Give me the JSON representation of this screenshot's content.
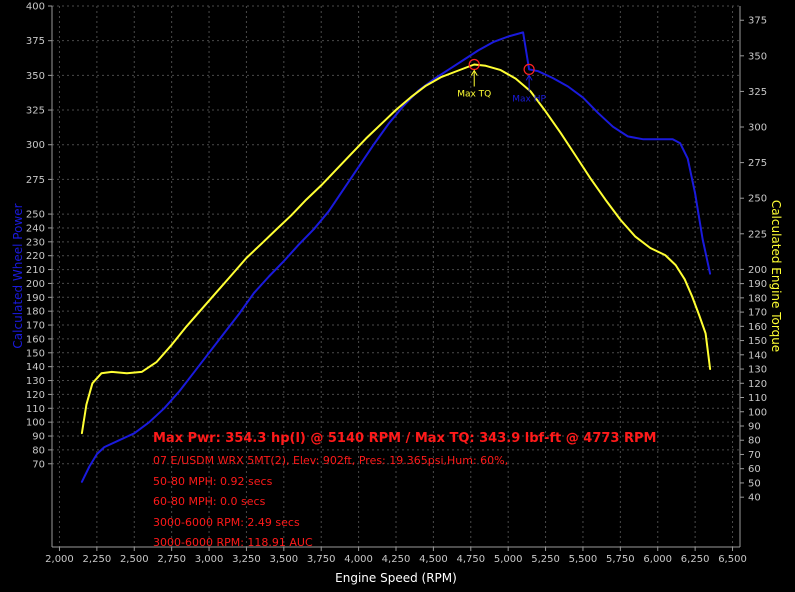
{
  "chart_data": {
    "type": "line",
    "xlabel": "Engine Speed (RPM)",
    "ylabel_left": "Calculated Wheel Power",
    "ylabel_right": "Calculated Engine Torque",
    "xlim": [
      1950,
      6550
    ],
    "ylim_left": [
      10,
      400
    ],
    "ylim_right": [
      5,
      385
    ],
    "x_ticks": [
      {
        "v": 2000,
        "label": "2,000"
      },
      {
        "v": 2250,
        "label": "2,250"
      },
      {
        "v": 2500,
        "label": "2,500"
      },
      {
        "v": 2750,
        "label": "2,750"
      },
      {
        "v": 3000,
        "label": "3,000"
      },
      {
        "v": 3250,
        "label": "3,250"
      },
      {
        "v": 3500,
        "label": "3,500"
      },
      {
        "v": 3750,
        "label": "3,750"
      },
      {
        "v": 4000,
        "label": "4,000"
      },
      {
        "v": 4250,
        "label": "4,250"
      },
      {
        "v": 4500,
        "label": "4,500"
      },
      {
        "v": 4750,
        "label": "4,750"
      },
      {
        "v": 5000,
        "label": "5,000"
      },
      {
        "v": 5250,
        "label": "5,250"
      },
      {
        "v": 5500,
        "label": "5,500"
      },
      {
        "v": 5750,
        "label": "5,750"
      },
      {
        "v": 6000,
        "label": "6,000"
      },
      {
        "v": 6250,
        "label": "6,250"
      },
      {
        "v": 6500,
        "label": "6,500"
      }
    ],
    "y_left_ticks": [
      70,
      80,
      90,
      100,
      110,
      120,
      130,
      140,
      150,
      160,
      170,
      180,
      190,
      200,
      210,
      220,
      230,
      240,
      250,
      275,
      300,
      325,
      350,
      375,
      400
    ],
    "y_right_ticks": [
      40,
      50,
      60,
      70,
      80,
      90,
      100,
      110,
      120,
      130,
      140,
      150,
      160,
      170,
      180,
      190,
      200,
      225,
      250,
      275,
      300,
      325,
      350,
      375
    ],
    "grid": true,
    "series": [
      {
        "name": "",
        "axis": "left",
        "color": "#1a1adc",
        "points": [
          [
            2150,
            57
          ],
          [
            2200,
            68
          ],
          [
            2250,
            77
          ],
          [
            2300,
            82
          ],
          [
            2400,
            87
          ],
          [
            2500,
            92
          ],
          [
            2600,
            100
          ],
          [
            2700,
            110
          ],
          [
            2800,
            122
          ],
          [
            2900,
            136
          ],
          [
            3000,
            150
          ],
          [
            3100,
            164
          ],
          [
            3200,
            178
          ],
          [
            3300,
            193
          ],
          [
            3400,
            205
          ],
          [
            3500,
            216
          ],
          [
            3600,
            228
          ],
          [
            3700,
            239
          ],
          [
            3800,
            252
          ],
          [
            3900,
            268
          ],
          [
            4000,
            284
          ],
          [
            4100,
            300
          ],
          [
            4200,
            315
          ],
          [
            4300,
            328
          ],
          [
            4400,
            339
          ],
          [
            4500,
            347
          ],
          [
            4600,
            354
          ],
          [
            4700,
            361
          ],
          [
            4800,
            368
          ],
          [
            4900,
            374
          ],
          [
            5000,
            378
          ],
          [
            5100,
            381
          ],
          [
            5140,
            354.3
          ],
          [
            5200,
            353
          ],
          [
            5300,
            348
          ],
          [
            5400,
            342
          ],
          [
            5500,
            334
          ],
          [
            5600,
            323
          ],
          [
            5700,
            313
          ],
          [
            5800,
            306
          ],
          [
            5900,
            304
          ],
          [
            6000,
            304
          ],
          [
            6100,
            304
          ],
          [
            6150,
            301
          ],
          [
            6200,
            290
          ],
          [
            6250,
            265
          ],
          [
            6300,
            232
          ],
          [
            6350,
            207
          ]
        ]
      },
      {
        "name": "",
        "axis": "right",
        "color": "#ffff33",
        "points": [
          [
            2150,
            85
          ],
          [
            2180,
            105
          ],
          [
            2220,
            120
          ],
          [
            2280,
            127
          ],
          [
            2350,
            128
          ],
          [
            2450,
            127
          ],
          [
            2550,
            128
          ],
          [
            2650,
            135
          ],
          [
            2750,
            147
          ],
          [
            2850,
            160
          ],
          [
            2950,
            172
          ],
          [
            3050,
            184
          ],
          [
            3150,
            196
          ],
          [
            3250,
            208
          ],
          [
            3350,
            218
          ],
          [
            3450,
            228
          ],
          [
            3550,
            238
          ],
          [
            3650,
            249
          ],
          [
            3750,
            259
          ],
          [
            3850,
            270
          ],
          [
            3950,
            281
          ],
          [
            4050,
            292
          ],
          [
            4150,
            302
          ],
          [
            4250,
            312
          ],
          [
            4350,
            321
          ],
          [
            4450,
            329
          ],
          [
            4550,
            335
          ],
          [
            4650,
            339
          ],
          [
            4773,
            343.9
          ],
          [
            4850,
            343
          ],
          [
            4950,
            340
          ],
          [
            5050,
            334
          ],
          [
            5150,
            325
          ],
          [
            5250,
            311
          ],
          [
            5350,
            296
          ],
          [
            5450,
            280
          ],
          [
            5550,
            264
          ],
          [
            5650,
            249
          ],
          [
            5750,
            235
          ],
          [
            5850,
            223
          ],
          [
            5950,
            215
          ],
          [
            6050,
            210
          ],
          [
            6120,
            203
          ],
          [
            6180,
            193
          ],
          [
            6230,
            181
          ],
          [
            6280,
            167
          ],
          [
            6320,
            155
          ],
          [
            6350,
            130
          ]
        ]
      }
    ],
    "markers": [
      {
        "label": "Max TQ",
        "x": 4773,
        "y": 343.9,
        "axis": "right",
        "color": "#ffff33"
      },
      {
        "label": "Max HP",
        "x": 5140,
        "y": 354.3,
        "axis": "left",
        "color": "#1a1adc"
      }
    ],
    "annotations": [
      "Max Pwr: 354.3 hp(l) @ 5140 RPM / Max TQ: 343.9 lbf-ft @ 4773 RPM",
      "07 E/USDM WRX 5MT(2), Elev: 902ft, Pres: 19.365psi,Hum: 60%,",
      "50-80 MPH: 0.92 secs",
      "60-80 MPH: 0.0 secs",
      "3000-6000 RPM: 2.49 secs",
      "3000-6000 RPM: 118.91 AUC"
    ],
    "colors": {
      "background": "#000000",
      "grid": "#4a4a4a",
      "axis_text": "#c8c8c8",
      "left_axis_title": "#1a1adc",
      "right_axis_title": "#ffff33",
      "annotation": "#ff1a1a"
    }
  }
}
